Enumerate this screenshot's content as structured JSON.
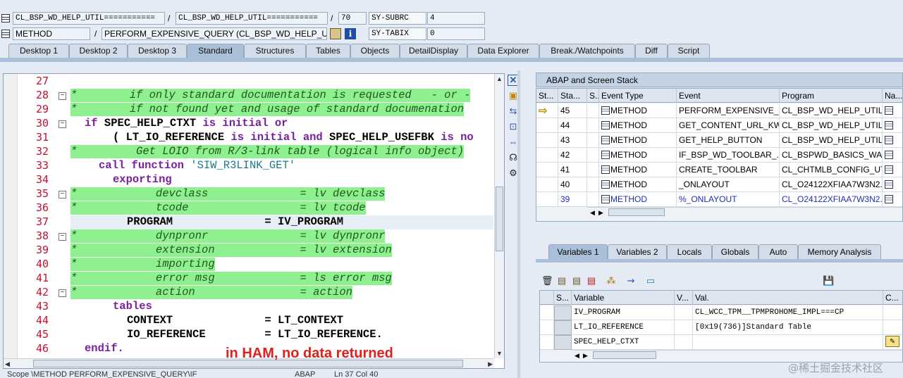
{
  "header": {
    "row1": {
      "class1": "CL_BSP_WD_HELP_UTIL===========",
      "class2": "CL_BSP_WD_HELP_UTIL===========",
      "line": "70",
      "sy_label": "SY-SUBRC",
      "sy_value": "4"
    },
    "row2": {
      "kind": "METHOD",
      "method": "PERFORM_EXPENSIVE_QUERY (CL_BSP_WD_HELP_UTI...",
      "sy_label": "SY-TABIX",
      "sy_value": "0"
    },
    "slash": "/"
  },
  "tabs": [
    "Desktop 1",
    "Desktop 2",
    "Desktop 3",
    "Standard",
    "Structures",
    "Tables",
    "Objects",
    "DetailDisplay",
    "Data Explorer",
    "Break./Watchpoints",
    "Diff",
    "Script"
  ],
  "code": [
    {
      "n": "27",
      "t": ""
    },
    {
      "n": "28",
      "t": "*        if only standard documentation is requested   - or -"
    },
    {
      "n": "29",
      "t": "*        if not found yet and usage of standard documenation"
    },
    {
      "n": "30",
      "t": "if SPEC_HELP_CTXT is initial or"
    },
    {
      "n": "31",
      "t": "( LT_IO_REFERENCE is initial and SPEC_HELP_USEFBK is no"
    },
    {
      "n": "32",
      "t": "*         Get LOIO from R/3-link table (logical info object)"
    },
    {
      "n": "33",
      "t": "call function 'SIW_R3LINK_GET'"
    },
    {
      "n": "34",
      "t": "exporting"
    },
    {
      "n": "35",
      "t": "*            devclass              = lv devclass"
    },
    {
      "n": "36",
      "t": "*            tcode                 = lv tcode"
    },
    {
      "n": "37",
      "t": "PROGRAM              = IV_PROGRAM"
    },
    {
      "n": "38",
      "t": "*            dynpronr              = lv dynpronr"
    },
    {
      "n": "39",
      "t": "*            extension             = lv extension"
    },
    {
      "n": "40",
      "t": "*            importing"
    },
    {
      "n": "41",
      "t": "*            error msg             = ls error msg"
    },
    {
      "n": "42",
      "t": "*            action                = action"
    },
    {
      "n": "43",
      "t": "tables"
    },
    {
      "n": "44",
      "t": "CONTEXT              = LT_CONTEXT"
    },
    {
      "n": "45",
      "t": "IO_REFERENCE         = LT_IO_REFERENCE."
    },
    {
      "n": "46",
      "t": "endif."
    }
  ],
  "annotation": "in HAM, no data returned",
  "status_bar": {
    "scope": "Scope \\METHOD PERFORM_EXPENSIVE_QUERY\\IF",
    "lang": "ABAP",
    "pos": "Ln  37 Col  40"
  },
  "stack": {
    "title": "ABAP and Screen Stack",
    "columns": [
      "St...",
      "Sta...",
      "S...",
      "Event Type",
      "Event",
      "Program",
      "Na..."
    ],
    "rows": [
      {
        "level": "45",
        "type": "METHOD",
        "event": "PERFORM_EXPENSIVE_Q...",
        "program": "CL_BSP_WD_HELP_UTIL..."
      },
      {
        "level": "44",
        "type": "METHOD",
        "event": "GET_CONTENT_URL_KW",
        "program": "CL_BSP_WD_HELP_UTIL..."
      },
      {
        "level": "43",
        "type": "METHOD",
        "event": "GET_HELP_BUTTON",
        "program": "CL_BSP_WD_HELP_UTIL..."
      },
      {
        "level": "42",
        "type": "METHOD",
        "event": "IF_BSP_WD_TOOLBAR_...",
        "program": "CL_BSPWD_BASICS_WA..."
      },
      {
        "level": "41",
        "type": "METHOD",
        "event": "CREATE_TOOLBAR",
        "program": "CL_CHTMLB_CONFIG_UT..."
      },
      {
        "level": "40",
        "type": "METHOD",
        "event": "_ONLAYOUT",
        "program": "CL_O24122XFIAA7W3N2..."
      },
      {
        "level": "39",
        "type": "METHOD",
        "event": "%_ONLAYOUT",
        "program": "CL_O24122XFIAA7W3N2..."
      }
    ]
  },
  "var_tabs": [
    "Variables 1",
    "Variables 2",
    "Locals",
    "Globals",
    "Auto",
    "Memory Analysis"
  ],
  "variables": {
    "columns": [
      "S...",
      "Variable",
      "V...",
      "Val.",
      "C..."
    ],
    "rows": [
      {
        "name": "IV_PROGRAM",
        "value": "CL_WCC_TPM__TPMPROHOME_IMPL===CP"
      },
      {
        "name": "LT_IO_REFERENCE",
        "value": "[0x19(736)]Standard Table"
      },
      {
        "name": "SPEC_HELP_CTXT",
        "value": ""
      }
    ]
  },
  "watermark": "@稀土掘金技术社区",
  "colors": {
    "comment_bg": "#8ff08f",
    "keyword": "#7a1fa0",
    "annotation": "#e0201c",
    "stack_link": "#1f2fb0"
  }
}
